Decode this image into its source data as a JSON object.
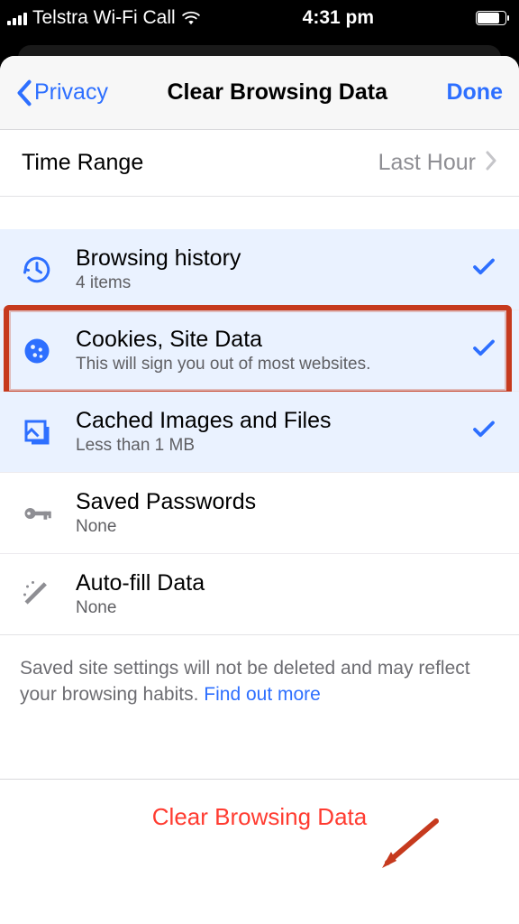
{
  "status_bar": {
    "carrier": "Telstra Wi-Fi Call",
    "time": "4:31 pm"
  },
  "nav": {
    "back_label": "Privacy",
    "title": "Clear Browsing Data",
    "done_label": "Done"
  },
  "time_range": {
    "label": "Time Range",
    "value": "Last Hour"
  },
  "options": [
    {
      "id": "browsing-history",
      "title": "Browsing history",
      "subtitle": "4 items",
      "selected": true,
      "highlighted": false
    },
    {
      "id": "cookies-site-data",
      "title": "Cookies, Site Data",
      "subtitle": "This will sign you out of most websites.",
      "selected": true,
      "highlighted": true
    },
    {
      "id": "cached-images-files",
      "title": "Cached Images and Files",
      "subtitle": "Less than 1 MB",
      "selected": true,
      "highlighted": false
    },
    {
      "id": "saved-passwords",
      "title": "Saved Passwords",
      "subtitle": "None",
      "selected": false,
      "highlighted": false
    },
    {
      "id": "autofill-data",
      "title": "Auto-fill Data",
      "subtitle": "None",
      "selected": false,
      "highlighted": false
    }
  ],
  "footer": {
    "text": "Saved site settings will not be deleted and may reflect your browsing habits. ",
    "link_text": "Find out more"
  },
  "clear_button": {
    "label": "Clear Browsing Data"
  },
  "colors": {
    "accent_blue": "#2d6fff",
    "destructive_red": "#ff3b30",
    "annotation_red": "#c63a1e",
    "muted_grey": "#8e8e93",
    "selected_bg": "#eaf2ff"
  }
}
